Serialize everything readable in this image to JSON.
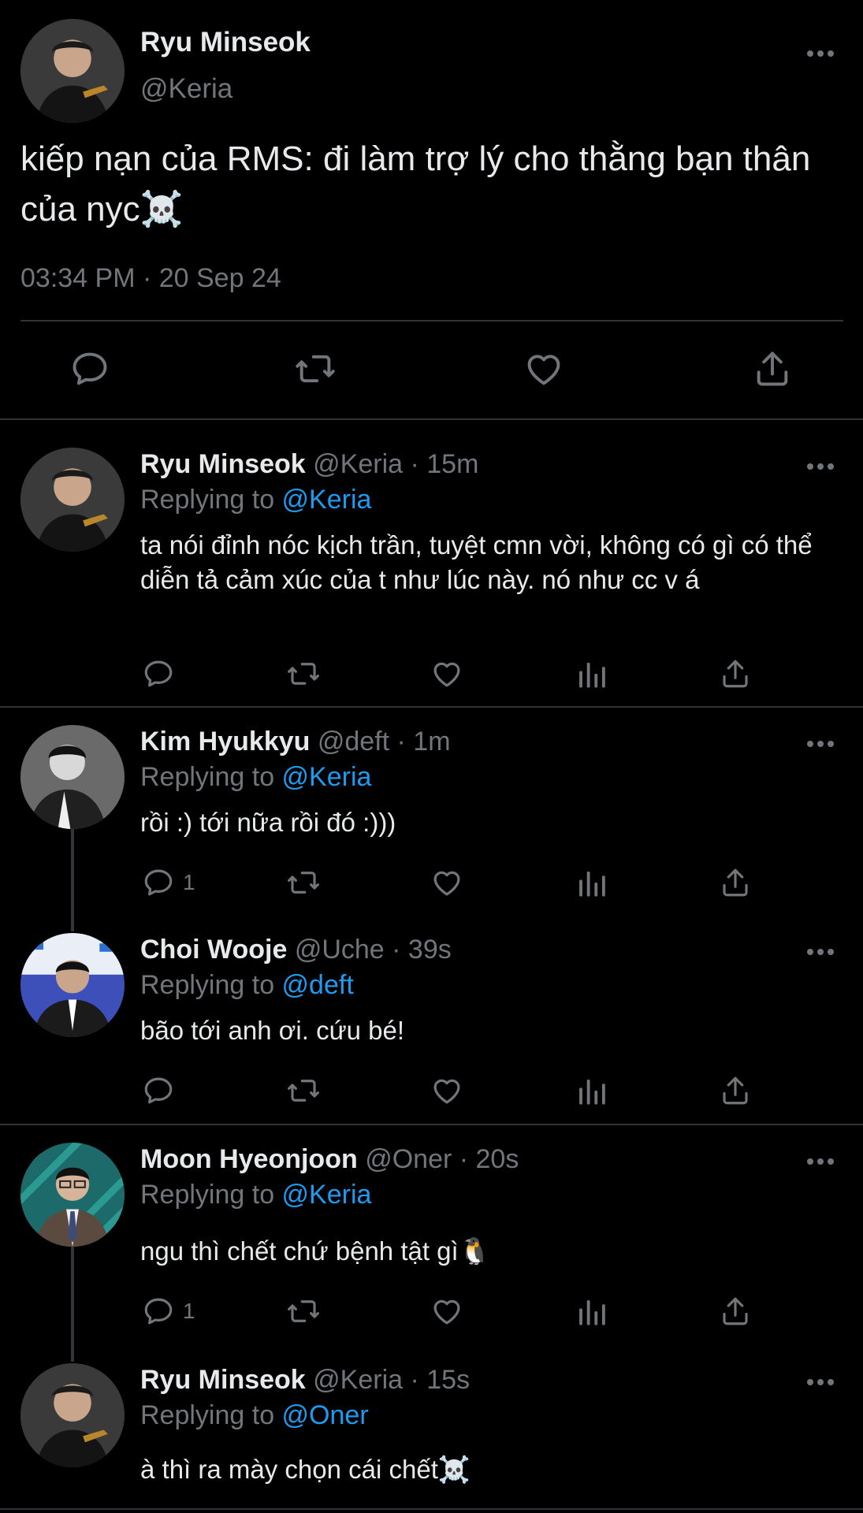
{
  "main_tweet": {
    "name": "Ryu Minseok",
    "handle": "@Keria",
    "text": "kiếp nạn của RMS: đi làm trợ lý cho thằng bạn thân của nyc☠️",
    "timestamp": "03:34 PM · 20 Sep 24"
  },
  "replies": [
    {
      "name": "Ryu Minseok",
      "meta": "@Keria · 15m",
      "replying_prefix": "Replying to ",
      "replying_to": "@Keria",
      "text": "ta nói đỉnh nóc kịch trần, tuyệt cmn vời, không có gì có thể diễn tả cảm xúc của t như lúc này. nó như cc v á",
      "reply_count": ""
    },
    {
      "name": "Kim Hyukkyu",
      "meta": "@deft · 1m",
      "replying_prefix": "Replying to ",
      "replying_to": "@Keria",
      "text": "rồi :) tới nữa rồi đó :)))",
      "reply_count": "1"
    },
    {
      "name": "Choi Wooje",
      "meta": "@Uche · 39s",
      "replying_prefix": "Replying to ",
      "replying_to": "@deft",
      "text": "bão tới anh ơi. cứu bé!",
      "reply_count": ""
    },
    {
      "name": "Moon Hyeonjoon",
      "meta": "@Oner · 20s",
      "replying_prefix": "Replying to ",
      "replying_to": "@Keria",
      "text": "ngu thì chết chứ bệnh tật gì🐧",
      "reply_count": "1"
    },
    {
      "name": "Ryu Minseok",
      "meta": "@Keria · 15s",
      "replying_prefix": "Replying to ",
      "replying_to": "@Oner",
      "text": "à thì ra mày chọn cái chết☠️",
      "reply_count": ""
    }
  ],
  "colors": {
    "background": "#000000",
    "text": "#e7e9ea",
    "secondary": "#71767b",
    "link": "#1d9bf0",
    "divider": "#2f3336"
  },
  "icons": [
    "reply-icon",
    "retweet-icon",
    "like-icon",
    "share-icon",
    "views-icon",
    "more-icon"
  ]
}
